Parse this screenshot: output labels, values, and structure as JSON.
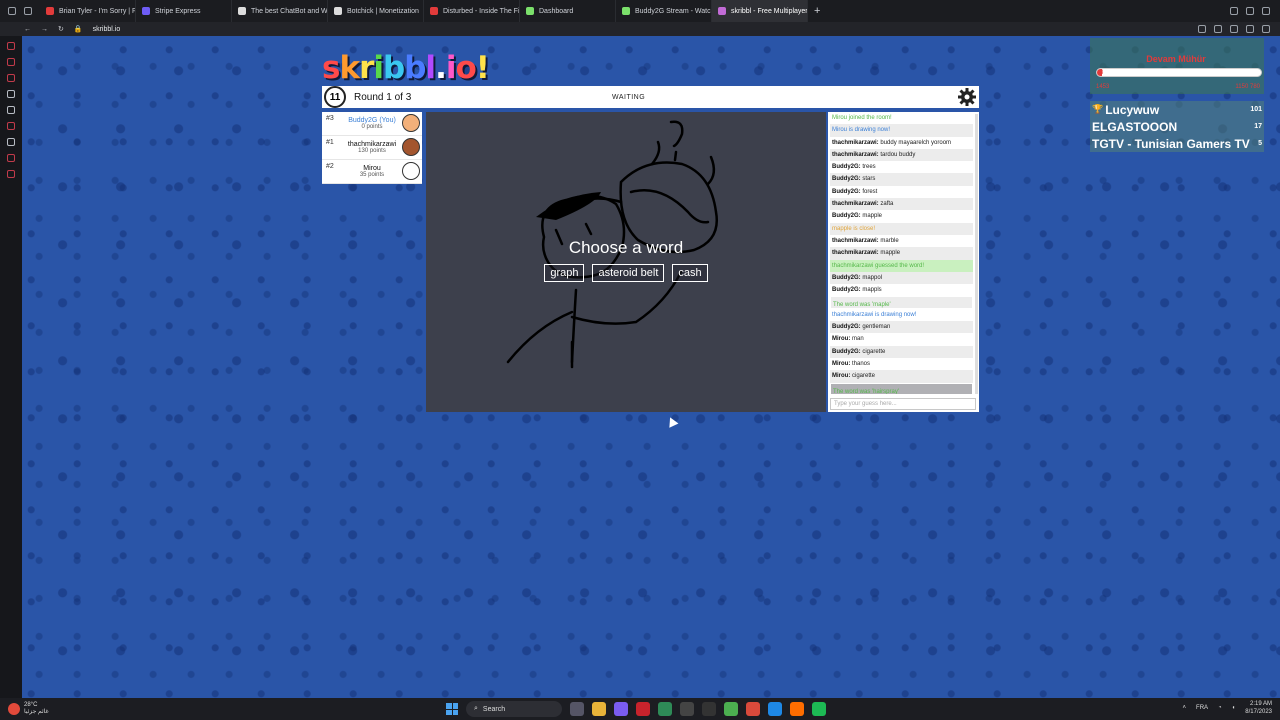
{
  "browser": {
    "tabs": [
      {
        "title": "Brian Tyler - I'm Sorry | Fa",
        "color": "#e23b3b"
      },
      {
        "title": "Stripe Express",
        "color": "#6e5cf5"
      },
      {
        "title": "The best ChatBot and W",
        "color": "#dcdcdc"
      },
      {
        "title": "Botchick | Monetization",
        "color": "#dcdcdc"
      },
      {
        "title": "Disturbed - Inside The Fi",
        "color": "#e23b3b"
      },
      {
        "title": "Dashboard",
        "color": "#7be06b"
      },
      {
        "title": "Buddy2G Stream - Watch",
        "color": "#7be06b"
      },
      {
        "title": "skribbl - Free Multiplayer",
        "color": "#c26bd6"
      }
    ],
    "new_tab": "+",
    "url": "skribbl.io"
  },
  "game": {
    "logo": [
      "s",
      "k",
      "r",
      "i",
      "b",
      "b",
      "l",
      ".",
      "i",
      "o",
      "!"
    ],
    "logo_colors": [
      "#ff4a4a",
      "#ff9a2e",
      "#ffe24a",
      "#59d94a",
      "#3ac8f0",
      "#4a7cff",
      "#b04aff",
      "#ffffff",
      "#ff58c8",
      "#ff4a4a",
      "#ffe24a"
    ],
    "timer": "11",
    "round": "Round 1 of 3",
    "status": "WAITING",
    "choose_title": "Choose a word",
    "words": [
      "graph",
      "asteroid belt",
      "cash"
    ],
    "guess_placeholder": "Type your guess here..."
  },
  "players": [
    {
      "rank": "#3",
      "name": "Buddy2G (You)",
      "points": "0 points",
      "me": true,
      "face": "#f2b07a"
    },
    {
      "rank": "#1",
      "name": "thachmikarzawi",
      "points": "130 points",
      "me": false,
      "face": "#a3552e"
    },
    {
      "rank": "#2",
      "name": "Mirou",
      "points": "35 points",
      "me": false,
      "face": "#ffffff"
    }
  ],
  "chat": [
    {
      "type": "join",
      "text": "Mirou joined the room!"
    },
    {
      "type": "draw",
      "text": "Mirou is drawing now!"
    },
    {
      "type": "msg",
      "name": "thachmikarzawi:",
      "text": " buddy mayaarelch yoroom"
    },
    {
      "type": "msg",
      "name": "thachmikarzawi:",
      "text": " tardou buddy"
    },
    {
      "type": "msg",
      "name": "Buddy2G:",
      "text": " trees"
    },
    {
      "type": "msg",
      "name": "Buddy2G:",
      "text": " stars"
    },
    {
      "type": "msg",
      "name": "Buddy2G:",
      "text": " forest"
    },
    {
      "type": "msg",
      "name": "thachmikarzawi:",
      "text": " zafta"
    },
    {
      "type": "msg",
      "name": "Buddy2G:",
      "text": " mapple"
    },
    {
      "type": "close",
      "text": "mapple is close!"
    },
    {
      "type": "msg",
      "name": "thachmikarzawi:",
      "text": " marble"
    },
    {
      "type": "msg",
      "name": "thachmikarzawi:",
      "text": " mapple"
    },
    {
      "type": "guessed",
      "text": "thachmikarzawi guessed the word!"
    },
    {
      "type": "msg",
      "name": "Buddy2G:",
      "text": " mappol"
    },
    {
      "type": "msg",
      "name": "Buddy2G:",
      "text": " mappls"
    },
    {
      "type": "word",
      "text": "The word was 'maple'"
    },
    {
      "type": "draw",
      "text": "thachmikarzawi is drawing now!"
    },
    {
      "type": "msg",
      "name": "Buddy2G:",
      "text": " gentleman"
    },
    {
      "type": "msg",
      "name": "Mirou:",
      "text": " man"
    },
    {
      "type": "msg",
      "name": "Buddy2G:",
      "text": " cigarette"
    },
    {
      "type": "msg",
      "name": "Mirou:",
      "text": " thanos"
    },
    {
      "type": "msg",
      "name": "Mirou:",
      "text": " cigarette"
    },
    {
      "type": "word",
      "text": "The word was 'hairspray'"
    }
  ],
  "overlay": {
    "title": "Devam Mühür",
    "count": "3",
    "progress": 0.03,
    "left": "1453",
    "right": "1150 780",
    "leaderboard": [
      {
        "name": "Lucywuw",
        "score": "101",
        "trophy": true
      },
      {
        "name": "ELGASTOOON",
        "score": "17",
        "trophy": false
      },
      {
        "name": "TGTV - Tunisian Gamers TV",
        "score": "5",
        "trophy": false
      }
    ]
  },
  "taskbar": {
    "weather_temp": "28°C",
    "weather_desc": "غائم جزئيا",
    "search": "Search",
    "lang": "FRA",
    "time": "2:19 AM",
    "date": "8/17/2023"
  }
}
